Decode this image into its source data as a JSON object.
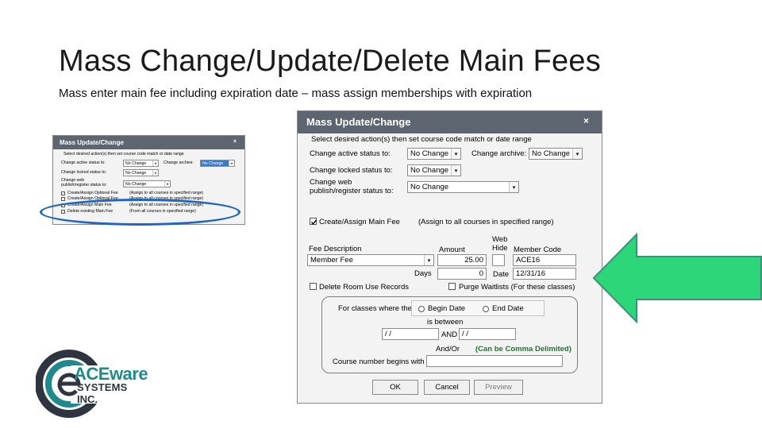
{
  "slide": {
    "title": "Mass Change/Update/Delete Main Fees",
    "subtitle": "Mass enter main fee including expiration date – mass assign memberships with expiration"
  },
  "big_dialog": {
    "title": "Mass Update/Change",
    "close_glyph": "×",
    "instructions": "Select desired action(s) then set course code match or date range",
    "active_label": "Change active status to:",
    "active_value": "No Change",
    "archive_label": "Change archive:",
    "archive_value": "No Change",
    "locked_label": "Change locked status to:",
    "locked_value": "No Change",
    "web_label_1": "Change web",
    "web_label_2": "publish/register status to:",
    "web_value": "No Change",
    "create_main_fee_label": "Create/Assign Main Fee",
    "create_main_fee_checked": true,
    "create_main_fee_note": "(Assign to all courses in specified range)",
    "fee_desc_header": "Fee Description",
    "amount_header": "Amount",
    "web_hide_header_1": "Web",
    "web_hide_header_2": "Hide",
    "member_code_header": "Member Code",
    "fee_desc_value": "Member Fee",
    "amount_value": "25.00",
    "member_code_value": "ACE16",
    "days_label": "Days",
    "days_value": "0",
    "date_label": "Date",
    "date_value": "12/31/16",
    "delete_room_label": "Delete Room Use Records",
    "purge_waitlists_label": "Purge Waitlists (For these classes)",
    "for_classes_label": "For classes where the",
    "begin_date_label": "Begin Date",
    "end_date_label": "End Date",
    "is_between_label": "is between",
    "date_from_value": " / /",
    "and_label": "AND",
    "date_to_value": " / /",
    "and_or_label": "And/Or",
    "comma_note": "(Can be Comma Delimited)",
    "course_number_label": "Course number begins with",
    "course_number_value": "",
    "ok_label": "OK",
    "cancel_label": "Cancel",
    "preview_label": "Preview",
    "dropdown_glyph": "▾"
  },
  "small_dialog": {
    "title": "Mass Update/Change",
    "close_glyph": "×",
    "instructions": "Select desired action(s) then set course code match or date range",
    "active_label": "Change active status to:",
    "active_value": "No Change",
    "archive_label": "Change archive:",
    "archive_value": "No Change",
    "locked_label": "Change locked status to:",
    "locked_value": "No Change",
    "web_label_1": "Change web",
    "web_label_2": "publish/register status to:",
    "web_value": "No Change",
    "rows": [
      {
        "label": "Create/Assign Optional Fee",
        "note": "(Assign to all courses in specified range)"
      },
      {
        "label": "Create/Assign Optional Fee",
        "note": "(Assign to all courses in specified range)"
      },
      {
        "label": "Create/Assign Main Fee",
        "note": "(Assign to all courses in specified range)"
      },
      {
        "label": "Delete existing Main Fee",
        "note": "(From all courses in specified range)"
      }
    ],
    "dropdown_glyph": "▾"
  },
  "logo": {
    "line1": "ACEware",
    "line2": "SYSTEMS",
    "line3": "INC."
  },
  "colors": {
    "titlebar": "#5c6570",
    "highlight_ellipse": "#1f66c2",
    "arrow_fill": "#2ed67a",
    "arrow_stroke": "#3e8f7a",
    "logo_teal": "#1f8a8c",
    "logo_dark": "#2e3440",
    "green_note": "#1a7a2c"
  }
}
